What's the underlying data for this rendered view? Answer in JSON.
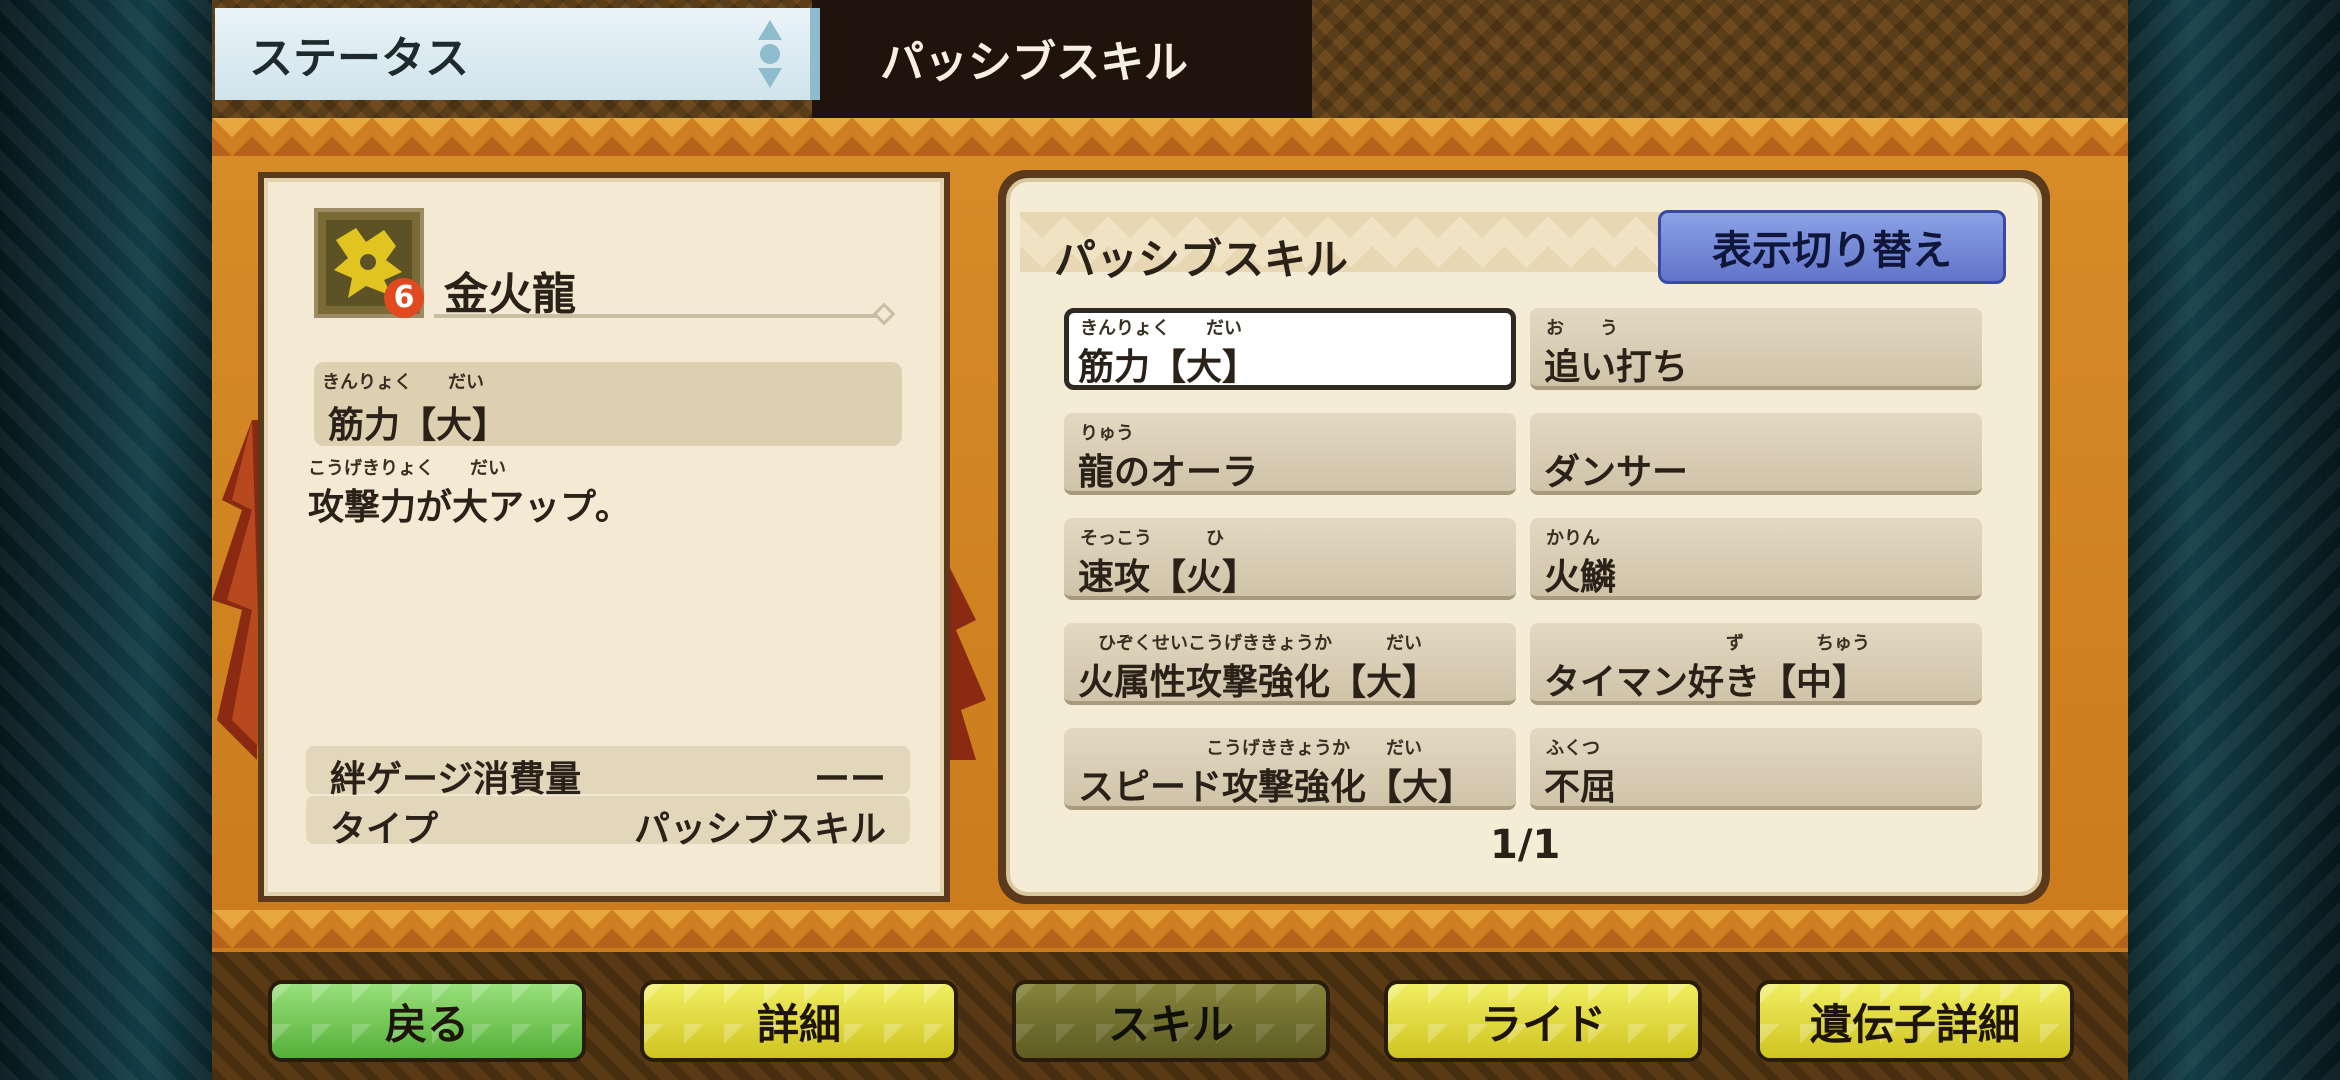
{
  "header": {
    "status_tab_label": "ステータス",
    "passive_tab_label": "パッシブスキル"
  },
  "detail": {
    "monster_name": "金火龍",
    "monster_level_badge": "6",
    "skill_ruby": "きんりょく　　だい",
    "skill_name": "筋力【大】",
    "description_ruby": "こうげきりょく　　だい",
    "description": "攻撃力が大アップ。",
    "info": [
      {
        "label": "絆ゲージ消費量",
        "value": "ーー"
      },
      {
        "label": "タイプ",
        "value": "パッシブスキル"
      }
    ]
  },
  "skills_panel": {
    "title": "パッシブスキル",
    "toggle_label": "表示切り替え",
    "page": "1/1",
    "skills": [
      {
        "ruby": "きんりょく　　だい",
        "label": "筋力【大】",
        "selected": true
      },
      {
        "ruby": "お　　う",
        "label": "追い打ち",
        "selected": false
      },
      {
        "ruby": "りゅう",
        "label": "龍のオーラ",
        "selected": false
      },
      {
        "ruby": "",
        "label": "ダンサー",
        "selected": false
      },
      {
        "ruby": "そっこう　　　ひ",
        "label": "速攻【火】",
        "selected": false
      },
      {
        "ruby": "かりん",
        "label": "火鱗",
        "selected": false
      },
      {
        "ruby": "　ひぞくせいこうげききょうか　　　だい",
        "label": "火属性攻撃強化【大】",
        "selected": false
      },
      {
        "ruby": "　　　　　　　　　　ず　　　　ちゅう",
        "label": "タイマン好き【中】",
        "selected": false
      },
      {
        "ruby": "　　　　　　　こうげききょうか　　だい",
        "label": "スピード攻撃強化【大】",
        "selected": false
      },
      {
        "ruby": "ふくつ",
        "label": "不屈",
        "selected": false
      }
    ]
  },
  "bottom_nav": {
    "back": "戻る",
    "detail": "詳細",
    "skill": "スキル",
    "ride": "ライド",
    "gene_detail": "遺伝子詳細"
  }
}
